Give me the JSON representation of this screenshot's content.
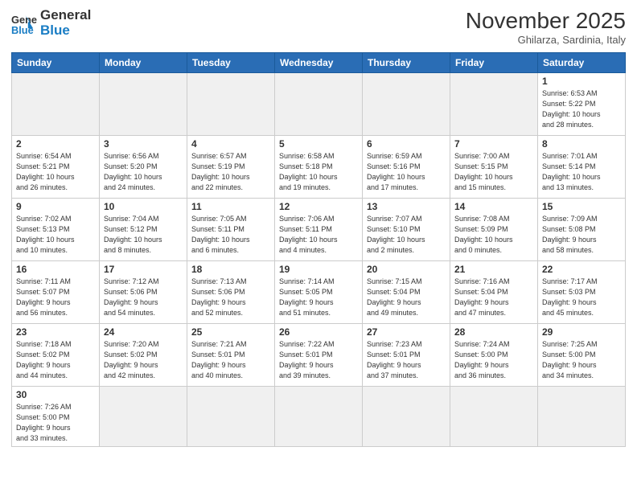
{
  "header": {
    "logo_general": "General",
    "logo_blue": "Blue",
    "month_title": "November 2025",
    "subtitle": "Ghilarza, Sardinia, Italy"
  },
  "days_of_week": [
    "Sunday",
    "Monday",
    "Tuesday",
    "Wednesday",
    "Thursday",
    "Friday",
    "Saturday"
  ],
  "weeks": [
    [
      {
        "day": "",
        "info": "",
        "empty": true
      },
      {
        "day": "",
        "info": "",
        "empty": true
      },
      {
        "day": "",
        "info": "",
        "empty": true
      },
      {
        "day": "",
        "info": "",
        "empty": true
      },
      {
        "day": "",
        "info": "",
        "empty": true
      },
      {
        "day": "",
        "info": "",
        "empty": true
      },
      {
        "day": "1",
        "info": "Sunrise: 6:53 AM\nSunset: 5:22 PM\nDaylight: 10 hours\nand 28 minutes."
      }
    ],
    [
      {
        "day": "2",
        "info": "Sunrise: 6:54 AM\nSunset: 5:21 PM\nDaylight: 10 hours\nand 26 minutes."
      },
      {
        "day": "3",
        "info": "Sunrise: 6:56 AM\nSunset: 5:20 PM\nDaylight: 10 hours\nand 24 minutes."
      },
      {
        "day": "4",
        "info": "Sunrise: 6:57 AM\nSunset: 5:19 PM\nDaylight: 10 hours\nand 22 minutes."
      },
      {
        "day": "5",
        "info": "Sunrise: 6:58 AM\nSunset: 5:18 PM\nDaylight: 10 hours\nand 19 minutes."
      },
      {
        "day": "6",
        "info": "Sunrise: 6:59 AM\nSunset: 5:16 PM\nDaylight: 10 hours\nand 17 minutes."
      },
      {
        "day": "7",
        "info": "Sunrise: 7:00 AM\nSunset: 5:15 PM\nDaylight: 10 hours\nand 15 minutes."
      },
      {
        "day": "8",
        "info": "Sunrise: 7:01 AM\nSunset: 5:14 PM\nDaylight: 10 hours\nand 13 minutes."
      }
    ],
    [
      {
        "day": "9",
        "info": "Sunrise: 7:02 AM\nSunset: 5:13 PM\nDaylight: 10 hours\nand 10 minutes."
      },
      {
        "day": "10",
        "info": "Sunrise: 7:04 AM\nSunset: 5:12 PM\nDaylight: 10 hours\nand 8 minutes."
      },
      {
        "day": "11",
        "info": "Sunrise: 7:05 AM\nSunset: 5:11 PM\nDaylight: 10 hours\nand 6 minutes."
      },
      {
        "day": "12",
        "info": "Sunrise: 7:06 AM\nSunset: 5:11 PM\nDaylight: 10 hours\nand 4 minutes."
      },
      {
        "day": "13",
        "info": "Sunrise: 7:07 AM\nSunset: 5:10 PM\nDaylight: 10 hours\nand 2 minutes."
      },
      {
        "day": "14",
        "info": "Sunrise: 7:08 AM\nSunset: 5:09 PM\nDaylight: 10 hours\nand 0 minutes."
      },
      {
        "day": "15",
        "info": "Sunrise: 7:09 AM\nSunset: 5:08 PM\nDaylight: 9 hours\nand 58 minutes."
      }
    ],
    [
      {
        "day": "16",
        "info": "Sunrise: 7:11 AM\nSunset: 5:07 PM\nDaylight: 9 hours\nand 56 minutes."
      },
      {
        "day": "17",
        "info": "Sunrise: 7:12 AM\nSunset: 5:06 PM\nDaylight: 9 hours\nand 54 minutes."
      },
      {
        "day": "18",
        "info": "Sunrise: 7:13 AM\nSunset: 5:06 PM\nDaylight: 9 hours\nand 52 minutes."
      },
      {
        "day": "19",
        "info": "Sunrise: 7:14 AM\nSunset: 5:05 PM\nDaylight: 9 hours\nand 51 minutes."
      },
      {
        "day": "20",
        "info": "Sunrise: 7:15 AM\nSunset: 5:04 PM\nDaylight: 9 hours\nand 49 minutes."
      },
      {
        "day": "21",
        "info": "Sunrise: 7:16 AM\nSunset: 5:04 PM\nDaylight: 9 hours\nand 47 minutes."
      },
      {
        "day": "22",
        "info": "Sunrise: 7:17 AM\nSunset: 5:03 PM\nDaylight: 9 hours\nand 45 minutes."
      }
    ],
    [
      {
        "day": "23",
        "info": "Sunrise: 7:18 AM\nSunset: 5:02 PM\nDaylight: 9 hours\nand 44 minutes."
      },
      {
        "day": "24",
        "info": "Sunrise: 7:20 AM\nSunset: 5:02 PM\nDaylight: 9 hours\nand 42 minutes."
      },
      {
        "day": "25",
        "info": "Sunrise: 7:21 AM\nSunset: 5:01 PM\nDaylight: 9 hours\nand 40 minutes."
      },
      {
        "day": "26",
        "info": "Sunrise: 7:22 AM\nSunset: 5:01 PM\nDaylight: 9 hours\nand 39 minutes."
      },
      {
        "day": "27",
        "info": "Sunrise: 7:23 AM\nSunset: 5:01 PM\nDaylight: 9 hours\nand 37 minutes."
      },
      {
        "day": "28",
        "info": "Sunrise: 7:24 AM\nSunset: 5:00 PM\nDaylight: 9 hours\nand 36 minutes."
      },
      {
        "day": "29",
        "info": "Sunrise: 7:25 AM\nSunset: 5:00 PM\nDaylight: 9 hours\nand 34 minutes."
      }
    ],
    [
      {
        "day": "30",
        "info": "Sunrise: 7:26 AM\nSunset: 5:00 PM\nDaylight: 9 hours\nand 33 minutes.",
        "last": true
      },
      {
        "day": "",
        "info": "",
        "empty": true,
        "last": true
      },
      {
        "day": "",
        "info": "",
        "empty": true,
        "last": true
      },
      {
        "day": "",
        "info": "",
        "empty": true,
        "last": true
      },
      {
        "day": "",
        "info": "",
        "empty": true,
        "last": true
      },
      {
        "day": "",
        "info": "",
        "empty": true,
        "last": true
      },
      {
        "day": "",
        "info": "",
        "empty": true,
        "last": true
      }
    ]
  ]
}
